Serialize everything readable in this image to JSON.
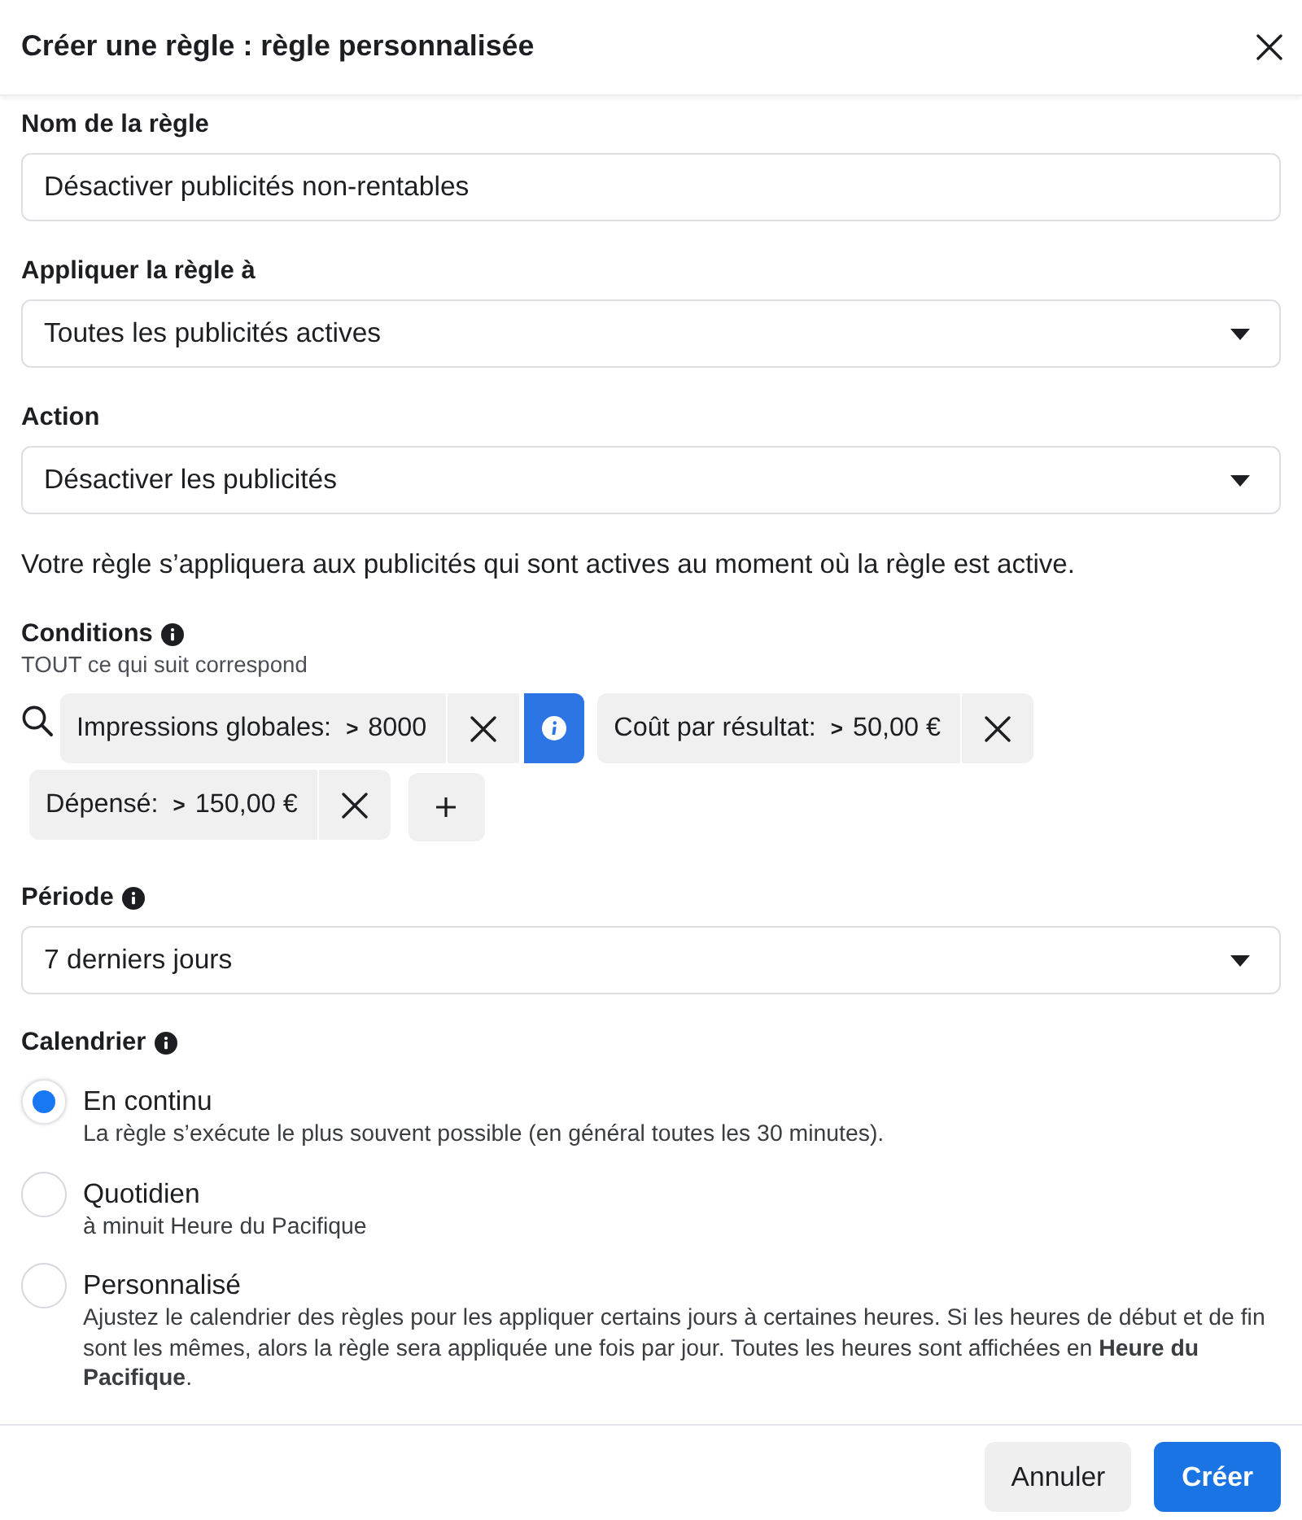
{
  "dialog": {
    "title": "Créer une règle : règle personnalisée"
  },
  "fields": [
    {
      "kind": "text",
      "label": "Nom de la règle",
      "value": "Désactiver publicités non-rentables"
    },
    {
      "kind": "select",
      "label": "Appliquer la règle à",
      "value": "Toutes les publicités actives"
    },
    {
      "kind": "select",
      "label": "Action",
      "value": "Désactiver les publicités"
    }
  ],
  "note": "Votre règle s’appliquera aux publicités qui sont actives au moment où la règle est active.",
  "conditions": {
    "label": "Conditions",
    "info": true,
    "subtitle": "TOUT ce qui suit correspond",
    "items": [
      {
        "metric": "Impressions globales:",
        "operator": ">",
        "value": "8000",
        "flagged": true
      },
      {
        "metric": "Coût par résultat:",
        "operator": ">",
        "value": "50,00 €",
        "flagged": false
      },
      {
        "metric": "Dépensé:",
        "operator": ">",
        "value": "150,00 €",
        "flagged": false
      }
    ]
  },
  "period": {
    "kind": "select",
    "label": "Période",
    "info": true,
    "value": "7 derniers jours"
  },
  "schedule": {
    "label": "Calendrier",
    "info": true,
    "options": [
      {
        "label": "En continu",
        "description": "La règle s’exécute le plus souvent possible (en général toutes les 30 minutes).",
        "selected": true
      },
      {
        "label": "Quotidien",
        "description": "à minuit Heure du Pacifique",
        "selected": false
      },
      {
        "label": "Personnalisé",
        "description": "Ajustez le calendrier des règles pour les appliquer certains jours à certaines heures. Si les heures de début et de fin sont les mêmes, alors la règle sera appliquée une fois par jour. Toutes les heures sont affichées en **Heure du Pacifique**.",
        "selected": false
      }
    ]
  },
  "buttons": [
    {
      "label": "Annuler",
      "kind": "secondary"
    },
    {
      "label": "Créer",
      "kind": "primary"
    }
  ]
}
